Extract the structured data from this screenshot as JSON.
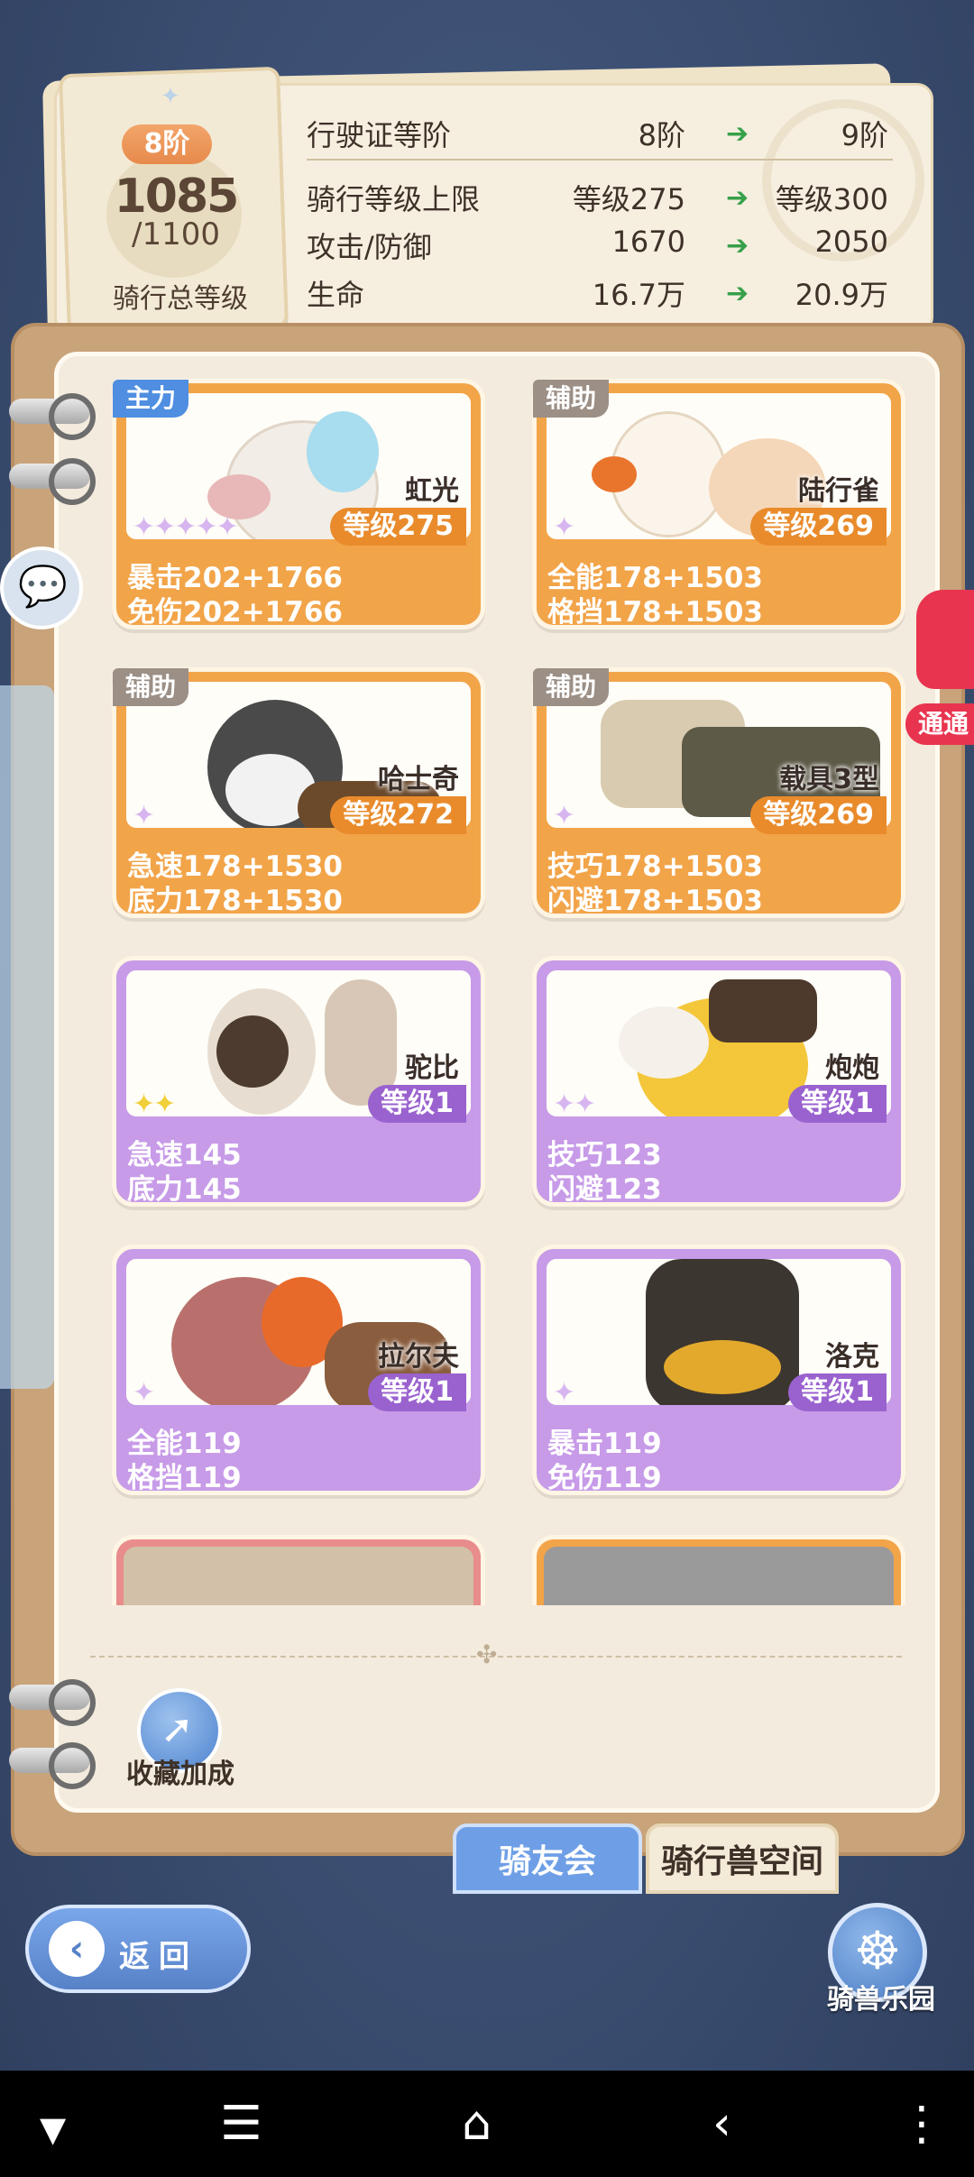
{
  "license": {
    "tier_badge": "8阶",
    "total_level": "1085",
    "max_level": "/1100",
    "total_label": "骑行总等级",
    "rows": [
      {
        "label": "行驶证等阶",
        "current": "8阶",
        "next": "9阶"
      },
      {
        "label": "骑行等级上限",
        "current": "等级275",
        "next": "等级300"
      },
      {
        "label": "攻击/防御",
        "current": "1670",
        "next": "2050"
      },
      {
        "label": "生命",
        "current": "16.7万",
        "next": "20.9万"
      }
    ],
    "arrow_icon": "green-arrow-right"
  },
  "cards": [
    {
      "role": "主力",
      "name": "虹光",
      "level": "等级275",
      "stars": "✦✦✦✦✦",
      "stat1": "暴击202+1766",
      "stat2": "免伤202+1766",
      "theme": "orange"
    },
    {
      "role": "辅助",
      "name": "陆行雀",
      "level": "等级269",
      "stars": "✦",
      "stat1": "全能178+1503",
      "stat2": "格挡178+1503",
      "theme": "orange"
    },
    {
      "role": "辅助",
      "name": "哈士奇",
      "level": "等级272",
      "stars": "✦",
      "stat1": "急速178+1530",
      "stat2": "底力178+1530",
      "theme": "orange"
    },
    {
      "role": "辅助",
      "name": "载具3型",
      "level": "等级269",
      "stars": "✦",
      "stat1": "技巧178+1503",
      "stat2": "闪避178+1503",
      "theme": "orange"
    },
    {
      "role": "",
      "name": "驼比",
      "level": "等级1",
      "stars": "✦✦",
      "stat1": "急速145",
      "stat2": "底力145",
      "theme": "purple"
    },
    {
      "role": "",
      "name": "炮炮",
      "level": "等级1",
      "stars": "✦✦",
      "stat1": "技巧123",
      "stat2": "闪避123",
      "theme": "purple"
    },
    {
      "role": "",
      "name": "拉尔夫",
      "level": "等级1",
      "stars": "✦",
      "stat1": "全能119",
      "stat2": "格挡119",
      "theme": "purple"
    },
    {
      "role": "",
      "name": "洛克",
      "level": "等级1",
      "stars": "✦",
      "stat1": "暴击119",
      "stat2": "免伤119",
      "theme": "purple"
    }
  ],
  "collection": {
    "label": "收藏加成"
  },
  "tabs": [
    {
      "label": "骑友会",
      "active": true
    },
    {
      "label": "骑行兽空间",
      "active": false
    }
  ],
  "back": {
    "label": "返回"
  },
  "park": {
    "label": "骑兽乐园"
  },
  "side_notice": {
    "label": "通通"
  },
  "colors": {
    "orange": "#f2a449",
    "purple": "#c79be8",
    "accent_blue": "#6e9fe6",
    "arrow_green": "#38a04a"
  }
}
